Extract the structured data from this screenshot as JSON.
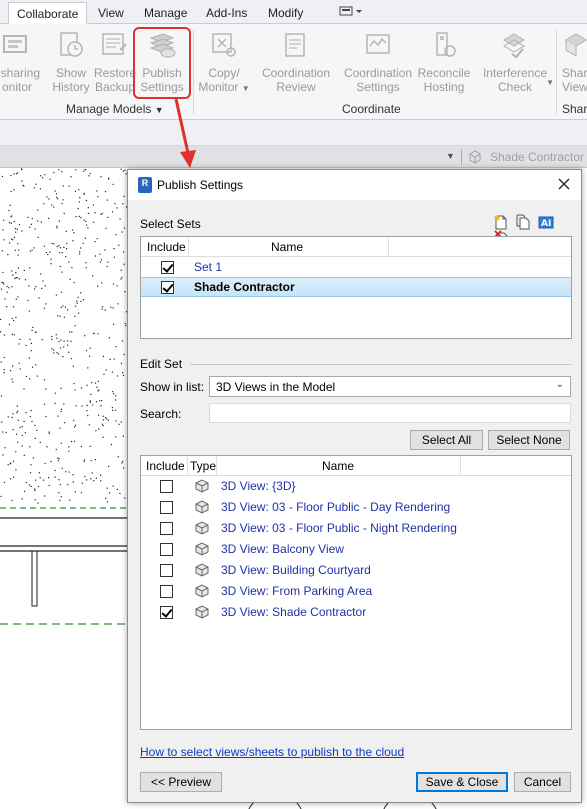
{
  "ribbon": {
    "tabs": [
      "Collaborate",
      "View",
      "Manage",
      "Add-Ins",
      "Modify"
    ],
    "active_tab": "Collaborate",
    "buttons": [
      {
        "line1": "esharing",
        "line2": "onitor"
      },
      {
        "line1": "Show",
        "line2": "History"
      },
      {
        "line1": "Restore",
        "line2": "Backup"
      },
      {
        "line1": "Publish",
        "line2": "Settings"
      },
      {
        "line1": "Copy/",
        "line2": "Monitor"
      },
      {
        "line1": "Coordination",
        "line2": "Review"
      },
      {
        "line1": "Coordination",
        "line2": "Settings"
      },
      {
        "line1": "Reconcile",
        "line2": "Hosting"
      },
      {
        "line1": "Interference",
        "line2": "Check"
      },
      {
        "line1": "Share",
        "line2": "View"
      }
    ],
    "panels": [
      "Manage Models",
      "Coordinate",
      "Shar"
    ]
  },
  "viewbar": {
    "label": "Shade Contractor"
  },
  "dialog": {
    "title": "Publish Settings",
    "select_sets_label": "Select Sets",
    "sets_columns": {
      "include": "Include",
      "name": "Name"
    },
    "sets": [
      {
        "name": "Set 1",
        "checked": true,
        "selected": false
      },
      {
        "name": "Shade Contractor",
        "checked": true,
        "selected": true
      }
    ],
    "edit_set_label": "Edit Set",
    "show_in_list_label": "Show in list:",
    "show_in_list_value": "3D Views in the Model",
    "search_label": "Search:",
    "select_all": "Select All",
    "select_none": "Select None",
    "views_columns": {
      "include": "Include",
      "type": "Type",
      "name": "Name"
    },
    "views": [
      {
        "name": "3D View: {3D}",
        "checked": false
      },
      {
        "name": "3D View: 03 - Floor Public - Day Rendering",
        "checked": false
      },
      {
        "name": "3D View: 03 - Floor Public - Night Rendering",
        "checked": false
      },
      {
        "name": "3D View: Balcony View",
        "checked": false
      },
      {
        "name": "3D View: Building Courtyard",
        "checked": false
      },
      {
        "name": "3D View: From Parking Area",
        "checked": false
      },
      {
        "name": "3D View: Shade Contractor",
        "checked": true
      }
    ],
    "help_link": "How to select views/sheets to publish to the cloud",
    "preview_button": "<< Preview",
    "save_close_button": "Save & Close",
    "cancel_button": "Cancel"
  },
  "colors": {
    "accent_red": "#e0312f",
    "link_blue": "#0b3bbf",
    "item_blue": "#2031a6"
  }
}
